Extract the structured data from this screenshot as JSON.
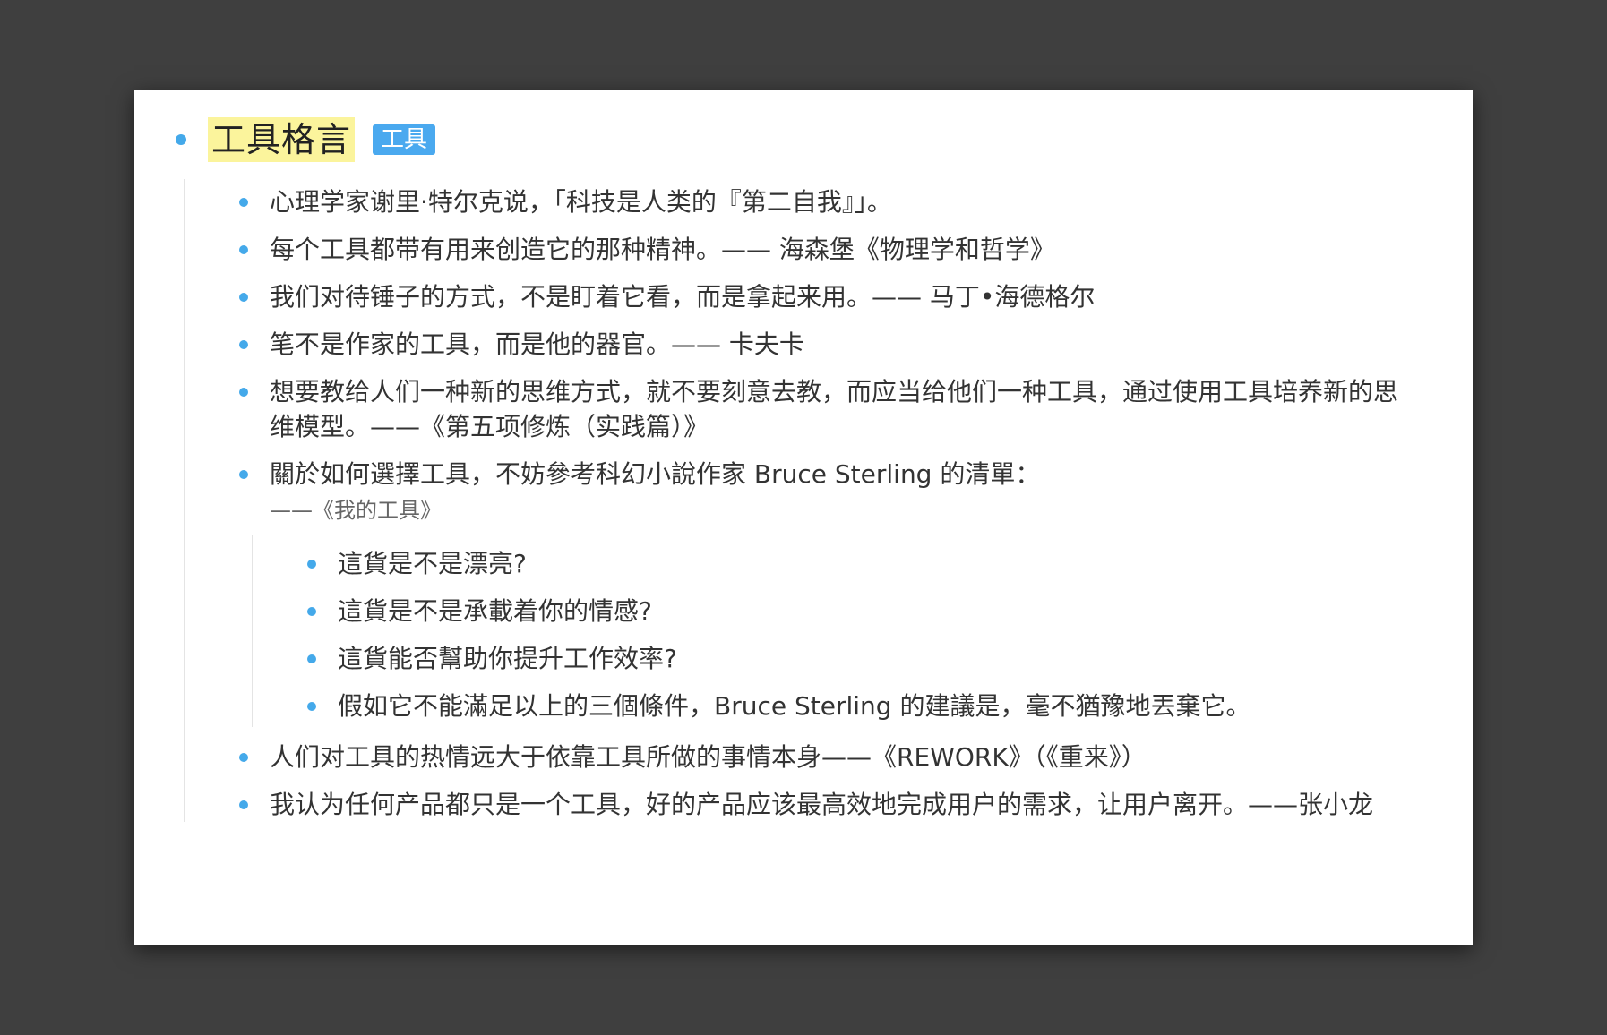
{
  "title": "工具格言",
  "tag": "工具",
  "quotes": [
    "心理学家谢里·特尔克说，「科技是人类的『第二自我』」。",
    "每个工具都带有用来创造它的那种精神。—— 海森堡《物理学和哲学》",
    "我们对待锤子的方式，不是盯着它看，而是拿起来用。—— 马丁•海德格尔",
    "笔不是作家的工具，而是他的器官。—— 卡夫卡",
    "想要教给人们一种新的思维方式，就不要刻意去教，而应当给他们一种工具，通过使用工具培养新的思维模型。——《第五项修炼（实践篇）》"
  ],
  "sterling": {
    "text": "關於如何選擇工具，不妨參考科幻小說作家 Bruce Sterling 的清單：",
    "source": "——《我的工具》",
    "items": [
      "這貨是不是漂亮?",
      "這貨是不是承載着你的情感?",
      "這貨能否幫助你提升工作效率?",
      "假如它不能滿足以上的三個條件，Bruce Sterling 的建議是，毫不猶豫地丟棄它。"
    ]
  },
  "quotes_after": [
    "人们对工具的热情远大于依靠工具所做的事情本身——《REWORK》（《重来》）",
    "我认为任何产品都只是一个工具，好的产品应该最高效地完成用户的需求，让用户离开。——张小龙"
  ]
}
